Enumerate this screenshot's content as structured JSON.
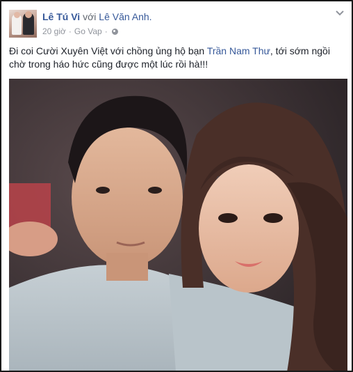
{
  "post": {
    "author": "Lê Tú Vi",
    "with_text": "với",
    "tagged": "Lê Văn Anh.",
    "time": "20 giờ",
    "separator": "·",
    "location": "Go Vap",
    "separator2": "·",
    "text_part1": "Đi coi Cười Xuyên Việt với chồng ủng hộ bạn ",
    "mention": "Trần Nam Thư",
    "text_part2": ", tới sớm ngồi chờ trong háo hức cũng được một lúc rồi hà!!!",
    "photo_icon": "selfie-photo",
    "options_icon": "chevron-down-icon",
    "privacy_icon": "globe-icon"
  }
}
